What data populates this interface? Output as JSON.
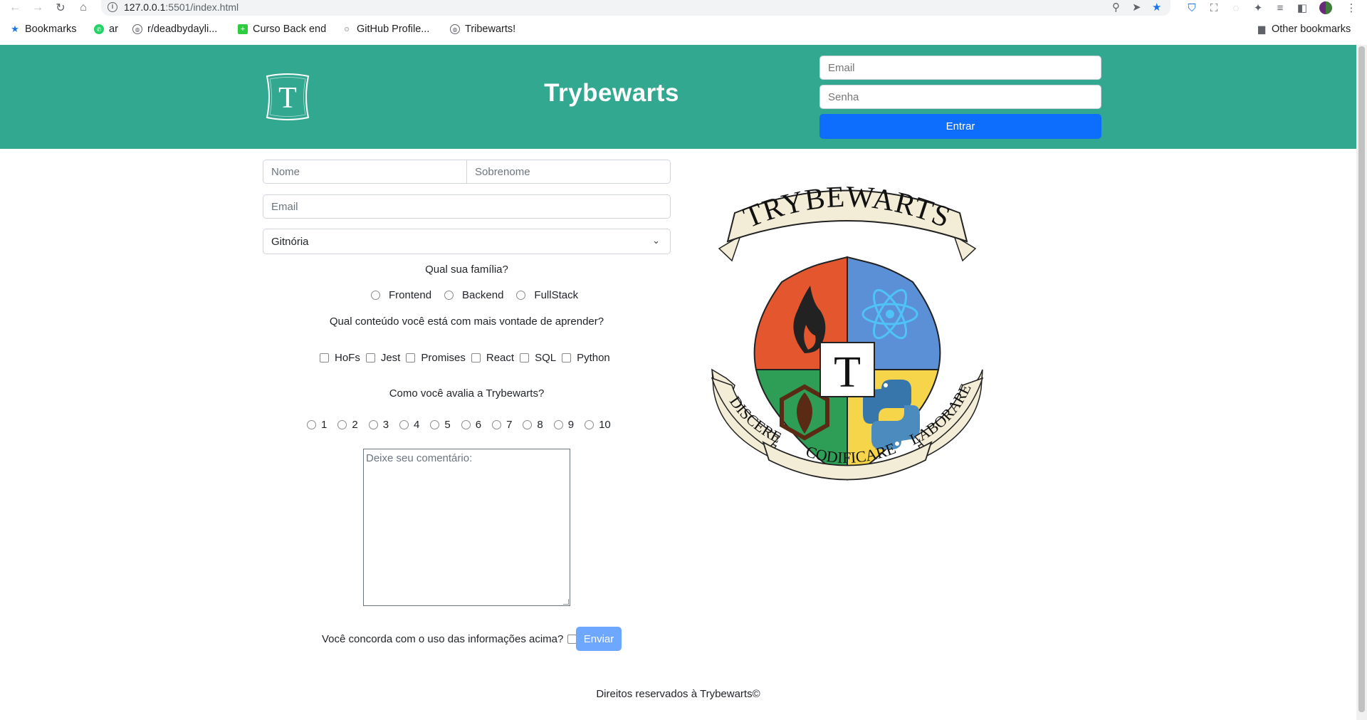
{
  "browser": {
    "url_host": "127.0.0.1",
    "url_path": ":5501/index.html",
    "bookmarks": [
      {
        "label": "Bookmarks",
        "icon": "star-icon"
      },
      {
        "label": "ar",
        "icon": "whatsapp-icon"
      },
      {
        "label": "r/deadbydayli...",
        "icon": "globe-icon"
      },
      {
        "label": "Curso Back end",
        "icon": "plus-icon"
      },
      {
        "label": "GitHub Profile...",
        "icon": "github-icon"
      },
      {
        "label": "Tribewarts!",
        "icon": "globe-icon"
      }
    ],
    "other_bookmarks": "Other bookmarks"
  },
  "header": {
    "logo_letter": "T",
    "title": "Trybewarts",
    "email_placeholder": "Email",
    "password_placeholder": "Senha",
    "login_label": "Entrar"
  },
  "form": {
    "first_name_placeholder": "Nome",
    "last_name_placeholder": "Sobrenome",
    "email_placeholder": "Email",
    "house_selected": "Gitnória",
    "family_question": "Qual sua família?",
    "families": [
      "Frontend",
      "Backend",
      "FullStack"
    ],
    "content_question": "Qual conteúdo você está com mais vontade de aprender?",
    "contents": [
      "HoFs",
      "Jest",
      "Promises",
      "React",
      "SQL",
      "Python"
    ],
    "rating_question": "Como você avalia a Trybewarts?",
    "ratings": [
      "1",
      "2",
      "3",
      "4",
      "5",
      "6",
      "7",
      "8",
      "9",
      "10"
    ],
    "comment_placeholder": "Deixe seu comentário:",
    "agreement_label": "Você concorda com o uso das informações acima?",
    "submit_label": "Enviar"
  },
  "crest": {
    "banner_text": "TRYBEWARTS",
    "center_letter": "T",
    "motto_left": "DISCERE",
    "motto_center": "CODIFICARE",
    "motto_right": "LABORARE"
  },
  "footer": {
    "text": "Direitos reservados à Trybewarts©"
  },
  "colors": {
    "header_bg": "#33a891",
    "login_button": "#0d6efd",
    "submit_button": "#6ea8fe",
    "crest_red": "#e4572e",
    "crest_blue": "#5b8fd6",
    "crest_green": "#2e9d55",
    "crest_yellow": "#f7d54a"
  }
}
